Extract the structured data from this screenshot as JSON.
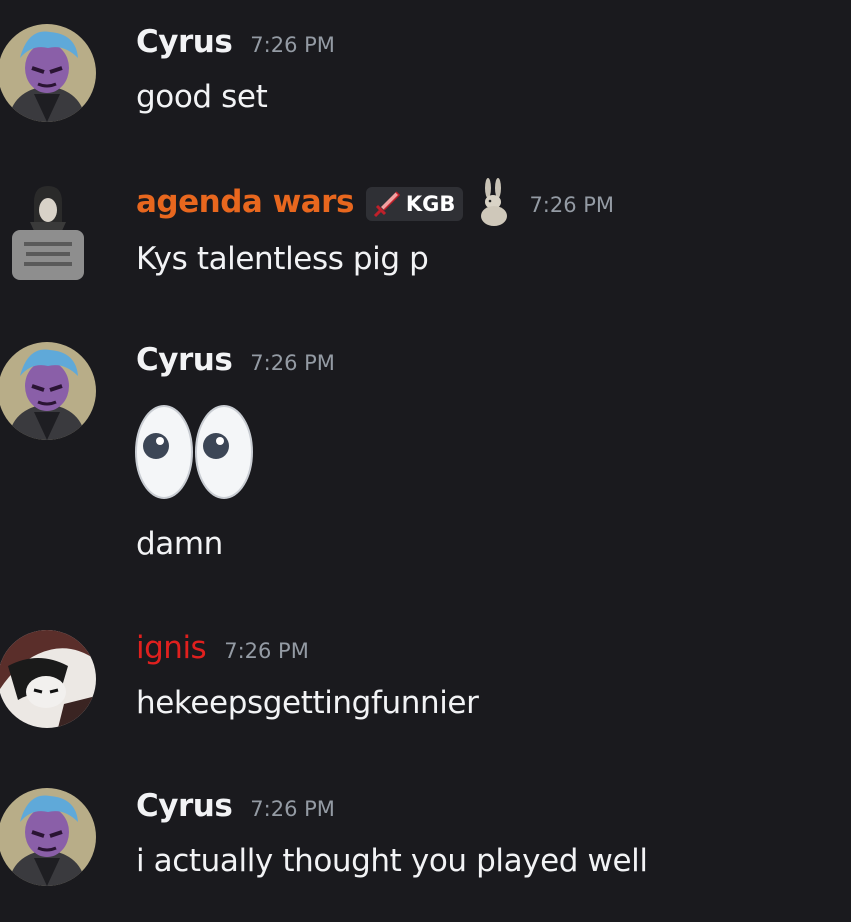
{
  "colors": {
    "background": "#1a1a1e",
    "username_default": "#f2f3f5",
    "username_agenda_wars": "#e8671e",
    "username_ignis": "#e0201e",
    "timestamp": "#949ba4",
    "message_text": "#f2f3f5"
  },
  "messages": [
    {
      "author": "Cyrus",
      "time": "7:26 PM",
      "text": "good set"
    },
    {
      "author": "agenda wars",
      "tag": "KGB",
      "tag_icon": "sword-icon",
      "badge_icon": "bunny-icon",
      "time": "7:26 PM",
      "text": "Kys talentless pig p"
    },
    {
      "author": "Cyrus",
      "time": "7:26 PM",
      "emoji": "eyes-emoji",
      "text": "damn"
    },
    {
      "author": "ignis",
      "time": "7:26 PM",
      "text": "hekeepsgettingfunnier"
    },
    {
      "author": "Cyrus",
      "time": "7:26 PM",
      "text": "i actually thought you played well"
    }
  ]
}
